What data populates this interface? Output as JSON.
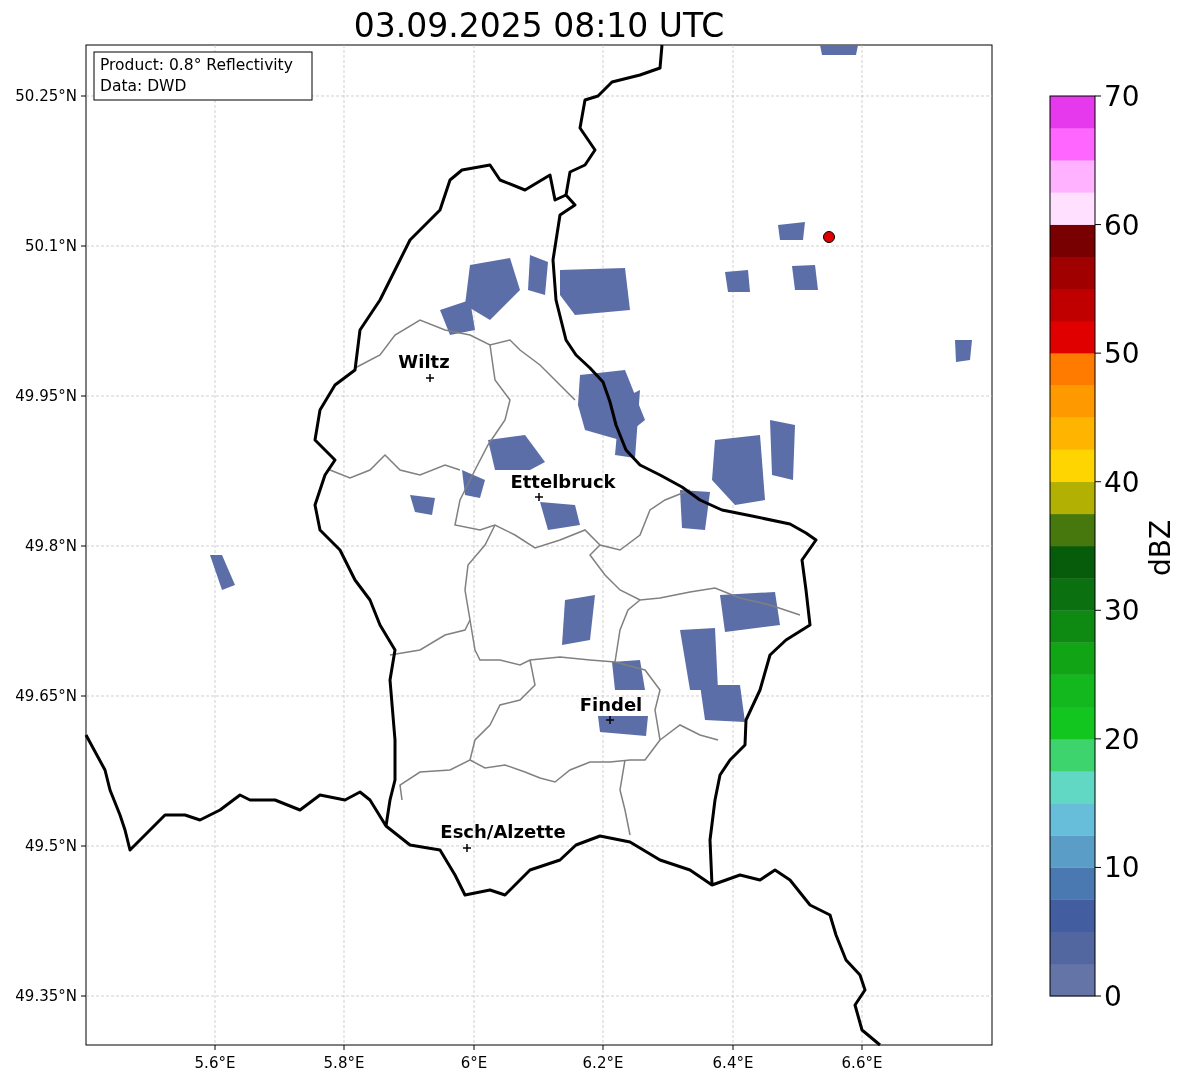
{
  "title": "03.09.2025 08:10 UTC",
  "info": [
    "Product: 0.8° Reflectivity",
    "Data: DWD"
  ],
  "cities": [
    "Wiltz",
    "Ettelbruck",
    "Findel",
    "Esch/Alzette"
  ],
  "x_ticks": [
    "5.6°E",
    "5.8°E",
    "6°E",
    "6.2°E",
    "6.4°E",
    "6.6°E"
  ],
  "y_ticks": [
    "50.25°N",
    "50.1°N",
    "49.95°N",
    "49.8°N",
    "49.65°N",
    "49.5°N",
    "49.35°N"
  ],
  "colorbar": {
    "label": "dBZ",
    "ticks": [
      "70",
      "60",
      "50",
      "40",
      "30",
      "20",
      "10",
      "0"
    ],
    "bins": [
      {
        "color": "#6574a6"
      },
      {
        "color": "#52669f"
      },
      {
        "color": "#435ea0"
      },
      {
        "color": "#4a78b0"
      },
      {
        "color": "#5a9ec8"
      },
      {
        "color": "#66bedb"
      },
      {
        "color": "#60d8c4"
      },
      {
        "color": "#3dd46e"
      },
      {
        "color": "#12c61f"
      },
      {
        "color": "#12b81d"
      },
      {
        "color": "#11a516"
      },
      {
        "color": "#0e8a12"
      },
      {
        "color": "#0a7010"
      },
      {
        "color": "#075c0c"
      },
      {
        "color": "#47780e"
      },
      {
        "color": "#b2b003"
      },
      {
        "color": "#fed500"
      },
      {
        "color": "#ffb400"
      },
      {
        "color": "#ff9900"
      },
      {
        "color": "#ff7b00"
      },
      {
        "color": "#e00000"
      },
      {
        "color": "#c00000"
      },
      {
        "color": "#a00000"
      },
      {
        "color": "#780000"
      },
      {
        "color": "#ffe0ff"
      },
      {
        "color": "#ffb2ff"
      },
      {
        "color": "#ff66ff"
      },
      {
        "color": "#e639ee"
      }
    ]
  }
}
